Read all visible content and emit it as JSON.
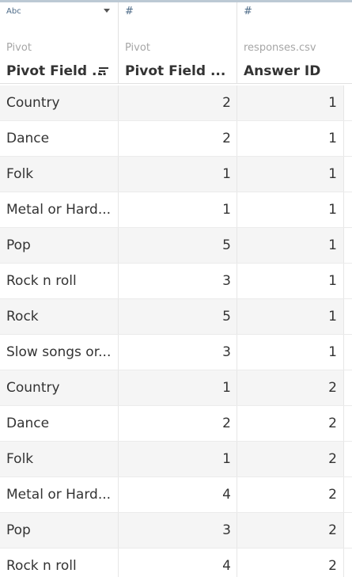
{
  "columns": [
    {
      "type_icon": "Abc",
      "source": "Pivot",
      "name": "Pivot Field ...",
      "has_dropdown": true,
      "sorted": true
    },
    {
      "type_icon": "#",
      "source": "Pivot",
      "name": "Pivot Field ..."
    },
    {
      "type_icon": "#",
      "source": "responses.csv",
      "name": "Answer ID"
    }
  ],
  "rows": [
    {
      "name": "Country",
      "value": "2",
      "answer_id": "1"
    },
    {
      "name": "Dance",
      "value": "2",
      "answer_id": "1"
    },
    {
      "name": "Folk",
      "value": "1",
      "answer_id": "1"
    },
    {
      "name": "Metal or Hard...",
      "value": "1",
      "answer_id": "1"
    },
    {
      "name": "Pop",
      "value": "5",
      "answer_id": "1"
    },
    {
      "name": "Rock n roll",
      "value": "3",
      "answer_id": "1"
    },
    {
      "name": "Rock",
      "value": "5",
      "answer_id": "1"
    },
    {
      "name": "Slow songs or...",
      "value": "3",
      "answer_id": "1"
    },
    {
      "name": "Country",
      "value": "1",
      "answer_id": "2"
    },
    {
      "name": "Dance",
      "value": "2",
      "answer_id": "2"
    },
    {
      "name": "Folk",
      "value": "1",
      "answer_id": "2"
    },
    {
      "name": "Metal or Hard...",
      "value": "4",
      "answer_id": "2"
    },
    {
      "name": "Pop",
      "value": "3",
      "answer_id": "2"
    },
    {
      "name": "Rock n roll",
      "value": "4",
      "answer_id": "2"
    }
  ],
  "icons": {
    "string_type": "abc-type-icon",
    "number_type": "hash-type-icon",
    "sort": "sort-descending-icon",
    "dropdown": "chevron-down-icon"
  },
  "colors": {
    "header_accent": "#bcc9d4",
    "type_icon": "#4c6a87",
    "row_alt": "#f5f5f5"
  }
}
